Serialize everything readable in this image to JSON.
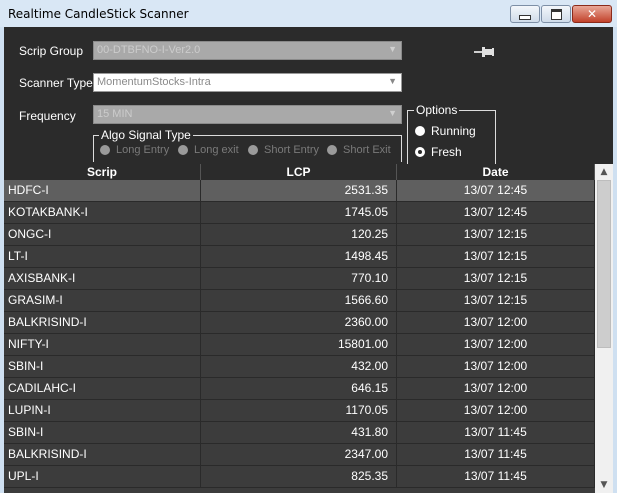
{
  "window": {
    "title": "Realtime CandleStick Scanner",
    "close_symbol": "✕"
  },
  "form": {
    "scrip_group": {
      "label": "Scrip Group",
      "value": "00-DTBFNO-I-Ver2.0"
    },
    "scanner_type": {
      "label": "Scanner Type",
      "value": "MomentumStocks-Intra"
    },
    "frequency": {
      "label": "Frequency",
      "value": "15 MIN"
    }
  },
  "options": {
    "title": "Options",
    "items": [
      {
        "label": "Running",
        "selected": false
      },
      {
        "label": "Fresh",
        "selected": true
      }
    ]
  },
  "algo_signal": {
    "title": "Algo Signal Type",
    "items": [
      {
        "label": "Long Entry",
        "selected": true
      },
      {
        "label": "Long exit",
        "selected": false
      },
      {
        "label": "Short Entry",
        "selected": false
      },
      {
        "label": "Short Exit",
        "selected": false
      }
    ]
  },
  "grid": {
    "columns": [
      "Scrip",
      "LCP",
      "Date"
    ],
    "selected_row": 0,
    "rows": [
      {
        "scrip": "HDFC-I",
        "lcp": "2531.35",
        "date": "13/07 12:45"
      },
      {
        "scrip": "KOTAKBANK-I",
        "lcp": "1745.05",
        "date": "13/07 12:45"
      },
      {
        "scrip": "ONGC-I",
        "lcp": "120.25",
        "date": "13/07 12:15"
      },
      {
        "scrip": "LT-I",
        "lcp": "1498.45",
        "date": "13/07 12:15"
      },
      {
        "scrip": "AXISBANK-I",
        "lcp": "770.10",
        "date": "13/07 12:15"
      },
      {
        "scrip": "GRASIM-I",
        "lcp": "1566.60",
        "date": "13/07 12:15"
      },
      {
        "scrip": "BALKRISIND-I",
        "lcp": "2360.00",
        "date": "13/07 12:00"
      },
      {
        "scrip": "NIFTY-I",
        "lcp": "15801.00",
        "date": "13/07 12:00"
      },
      {
        "scrip": "SBIN-I",
        "lcp": "432.00",
        "date": "13/07 12:00"
      },
      {
        "scrip": "CADILAHC-I",
        "lcp": "646.15",
        "date": "13/07 12:00"
      },
      {
        "scrip": "LUPIN-I",
        "lcp": "1170.05",
        "date": "13/07 12:00"
      },
      {
        "scrip": "SBIN-I",
        "lcp": "431.80",
        "date": "13/07 11:45"
      },
      {
        "scrip": "BALKRISIND-I",
        "lcp": "2347.00",
        "date": "13/07 11:45"
      },
      {
        "scrip": "UPL-I",
        "lcp": "825.35",
        "date": "13/07 11:45"
      }
    ]
  },
  "icons": {
    "pin": "pin-icon",
    "minimize": "minimize-icon",
    "maximize": "maximize-icon",
    "close": "close-icon",
    "dropdown": "chevron-down-icon"
  },
  "colors": {
    "panel_bg": "#2b2b2b",
    "grid_bg": "#3c3c3c",
    "selected_row": "#5f5f5f",
    "close_button": "#c2422b"
  }
}
